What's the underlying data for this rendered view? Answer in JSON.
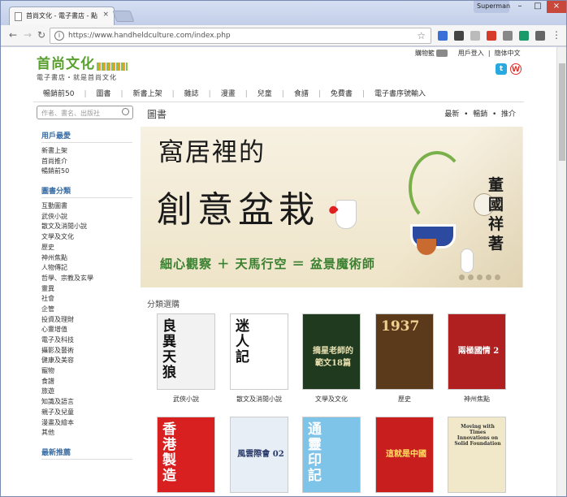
{
  "browser": {
    "tab_title": "首尚文化 - 電子書店 - 點",
    "tab_close": "×",
    "user": "Superman",
    "window_controls": [
      "–",
      "□",
      "×"
    ],
    "url": "https://www.handheldculture.com/index.php",
    "nav_icons": [
      "back-icon",
      "forward-icon",
      "reload-icon"
    ],
    "extensions": [
      {
        "name": "ext-icon",
        "color": "#3a6fd8"
      },
      {
        "name": "eyedropper-icon",
        "color": "#444444"
      },
      {
        "name": "ext-icon",
        "color": "#bbbbbb"
      },
      {
        "name": "ext-icon",
        "color": "#d83a2a"
      },
      {
        "name": "ext-icon",
        "color": "#888888"
      },
      {
        "name": "ext-icon",
        "color": "#1a9a6a"
      },
      {
        "name": "ext-icon",
        "color": "#666666"
      }
    ],
    "menu_icon": "⋮"
  },
  "site": {
    "logo": "首尚文化",
    "slogan": "電子書店・就是首尚文化",
    "top_links": {
      "cart": "購物籃",
      "login": "用戶登入",
      "language": "簡体中文",
      "sep": "|"
    },
    "social": [
      "twitter-icon",
      "weibo-icon"
    ],
    "main_nav": [
      "暢銷前50",
      "圖書",
      "新書上架",
      "雜誌",
      "漫畫",
      "兒童",
      "食譜",
      "免費書",
      "電子書序號輸入"
    ],
    "main_nav_sep": "|",
    "search_placeholder": "作者、書名、出版社"
  },
  "sidebar": {
    "sections": [
      {
        "title": "用戶最愛",
        "items": [
          "新書上架",
          "首尚推介",
          "暢銷前50"
        ]
      },
      {
        "title": "圖書分類",
        "items": [
          "互動圖書",
          "武俠小說",
          "散文及消閒小說",
          "文學及文化",
          "歷史",
          "神州焦點",
          "人物傳記",
          "哲學、宗教及玄學",
          "靈異",
          "社會",
          "企管",
          "投資及理財",
          "心靈增值",
          "電子及科技",
          "攝影及藝術",
          "健康及美容",
          "寵物",
          "食譜",
          "旅遊",
          "知識及語言",
          "親子及兒童",
          "漫畫及繪本",
          "其他"
        ]
      },
      {
        "title": "最新推薦",
        "items": []
      }
    ]
  },
  "content": {
    "title": "圖書",
    "tabs": [
      "最新",
      "暢銷",
      "推介"
    ],
    "tab_sep": "•",
    "banner": {
      "line1": "窩居裡的",
      "line2": "創意盆栽",
      "line3": "細心觀察 ＋ 天馬行空 ＝ 盆景魔術師",
      "author": "董國祥著",
      "slide_count": 5
    },
    "category_title": "分類選購",
    "books": [
      {
        "label": "武俠小說",
        "cover_text": "良異天狼",
        "bg": "#f2f2f2",
        "fg": "#111111"
      },
      {
        "label": "散文及消閒小說",
        "cover_text": "迷人記",
        "bg": "#ffffff",
        "fg": "#111111"
      },
      {
        "label": "文學及文化",
        "cover_text": "摘星老師的範文18篇",
        "bg": "#1f3a1f",
        "fg": "#e8e0b0"
      },
      {
        "label": "歷史",
        "cover_text": "1937",
        "bg": "#5a3a1a",
        "fg": "#f0d090"
      },
      {
        "label": "神州焦點",
        "cover_text": "兩極國情 2",
        "bg": "#b02020",
        "fg": "#ffffff"
      },
      {
        "label": "",
        "cover_text": "香港製造",
        "bg": "#d82020",
        "fg": "#ffffff"
      },
      {
        "label": "",
        "cover_text": "風雲際會 02",
        "bg": "#e8eef6",
        "fg": "#2a3a6a"
      },
      {
        "label": "",
        "cover_text": "通靈印記",
        "bg": "#7ec3e8",
        "fg": "#ffffff"
      },
      {
        "label": "",
        "cover_text": "這就是中國",
        "bg": "#c81e1e",
        "fg": "#ffe060"
      },
      {
        "label": "",
        "cover_text": "Moving with Times Innovations on Solid Foundation",
        "bg": "#f0e8c8",
        "fg": "#333333"
      }
    ]
  },
  "colors": {
    "accent_green": "#5aa030",
    "sidebar_heading": "#3a6ea5"
  }
}
